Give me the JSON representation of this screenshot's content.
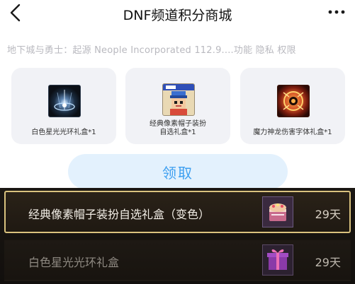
{
  "nav": {
    "title": "DNF频道积分商城"
  },
  "subtitle": "地下城与勇士：起源 Neople Incorporated 112.9....功能 隐私 权限",
  "rewards": [
    {
      "label": "白色星光光环礼盒*1",
      "icon": "white-starlight-aura-icon"
    },
    {
      "label": "经典像素帽子装扮\n自选礼盒*1",
      "icon": "pixel-hat-costume-icon"
    },
    {
      "label": "魔力神龙伤害字体礼盒*1",
      "icon": "dragon-damage-font-icon"
    }
  ],
  "claim_button": "领取",
  "inventory": [
    {
      "name": "经典像素帽子装扮自选礼盒（变色）",
      "duration": "29天",
      "selected": true,
      "icon": "cake-gift-box-icon"
    },
    {
      "name": "白色星光光环礼盒",
      "duration": "29天",
      "selected": false,
      "icon": "purple-gift-box-icon"
    }
  ],
  "colors": {
    "accent": "#3d9ff0",
    "claim_bg": "#e3f1fd",
    "card_bg": "#f1f2f6",
    "selected_border": "#d9c27e"
  }
}
